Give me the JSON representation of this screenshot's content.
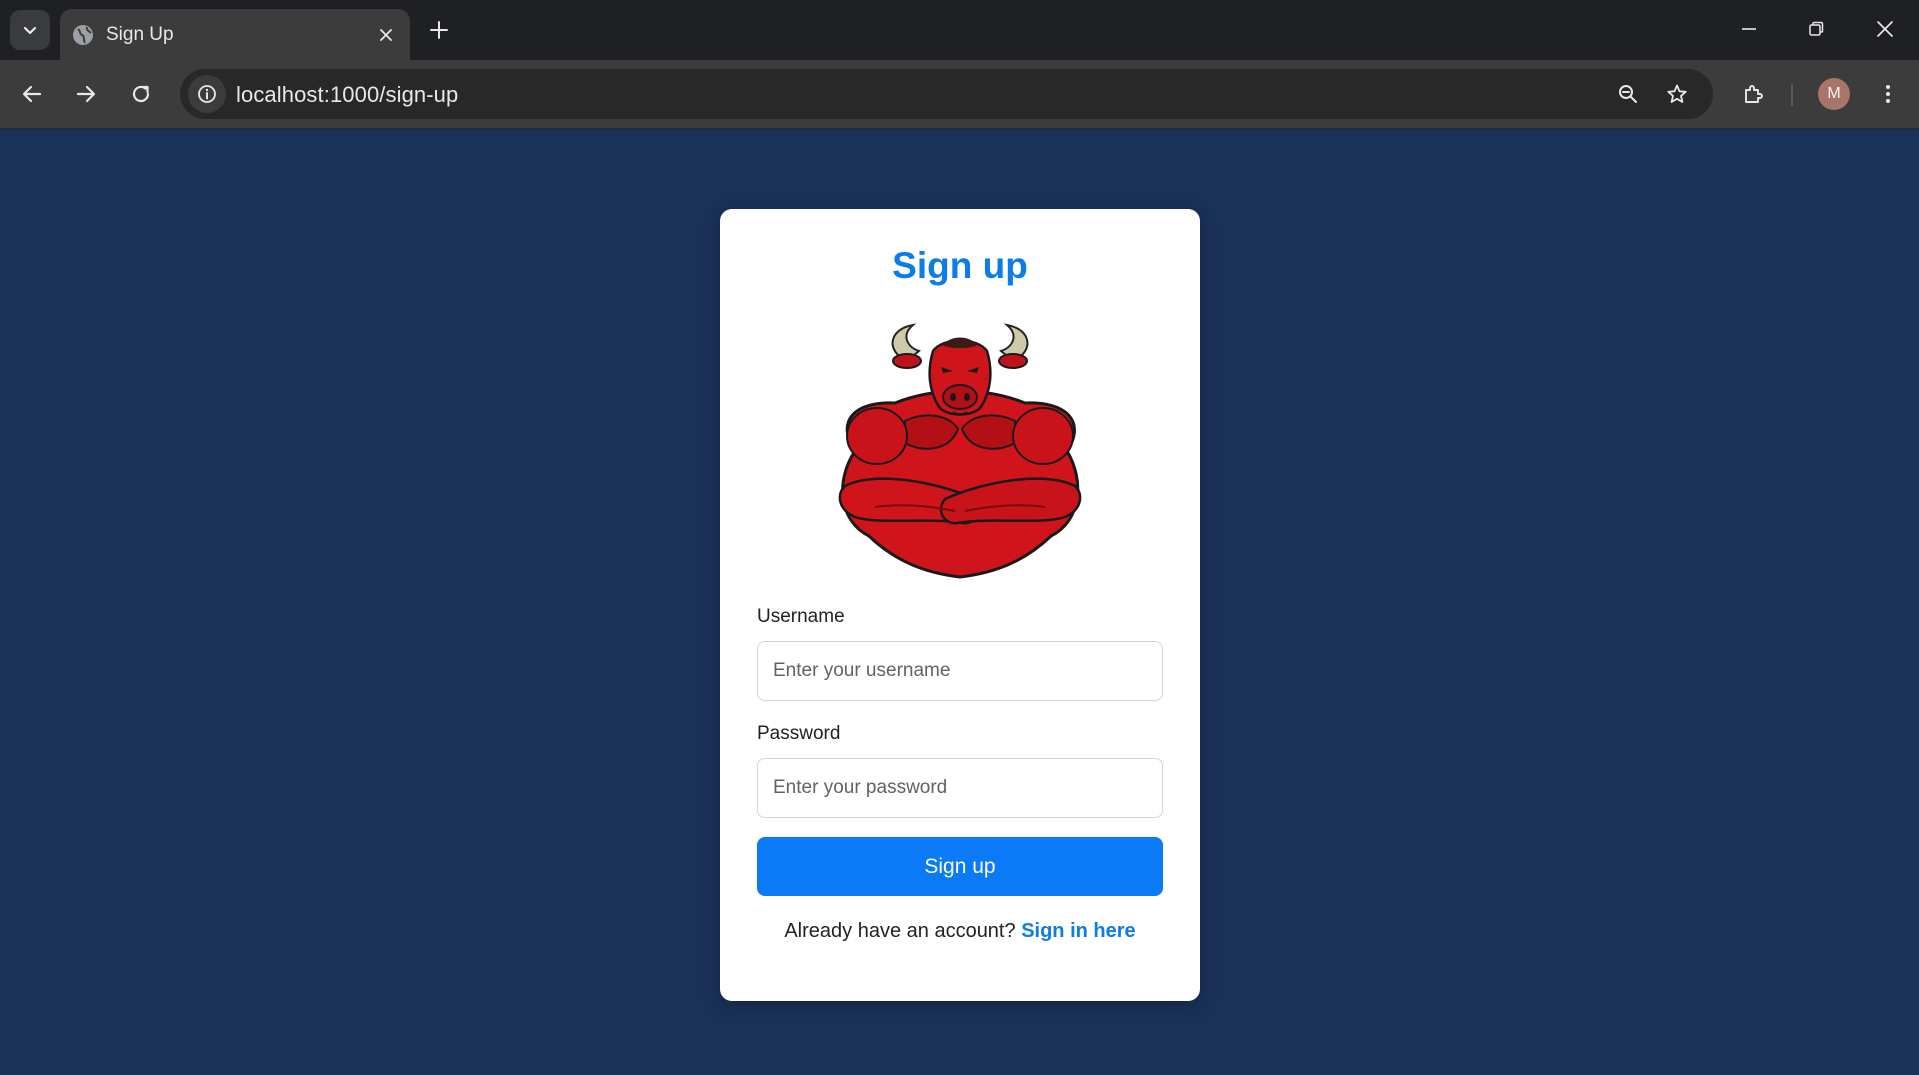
{
  "browser": {
    "tab_title": "Sign Up",
    "url": "localhost:1000/sign-up",
    "profile_initial": "M"
  },
  "page": {
    "title": "Sign up",
    "username_label": "Username",
    "username_placeholder": "Enter your username",
    "password_label": "Password",
    "password_placeholder": "Enter your password",
    "submit_label": "Sign up",
    "signin_prompt": "Already have an account?",
    "signin_link": "Sign in here"
  },
  "colors": {
    "page_background": "#1a3158",
    "accent": "#0a7af7",
    "logo_red": "#d0141c"
  },
  "icons": [
    "tab-list-icon",
    "globe-icon",
    "close-icon",
    "plus-icon",
    "minimize-icon",
    "restore-icon",
    "back-icon",
    "forward-icon",
    "reload-icon",
    "info-icon",
    "zoom-icon",
    "star-icon",
    "extensions-icon",
    "menu-icon"
  ]
}
